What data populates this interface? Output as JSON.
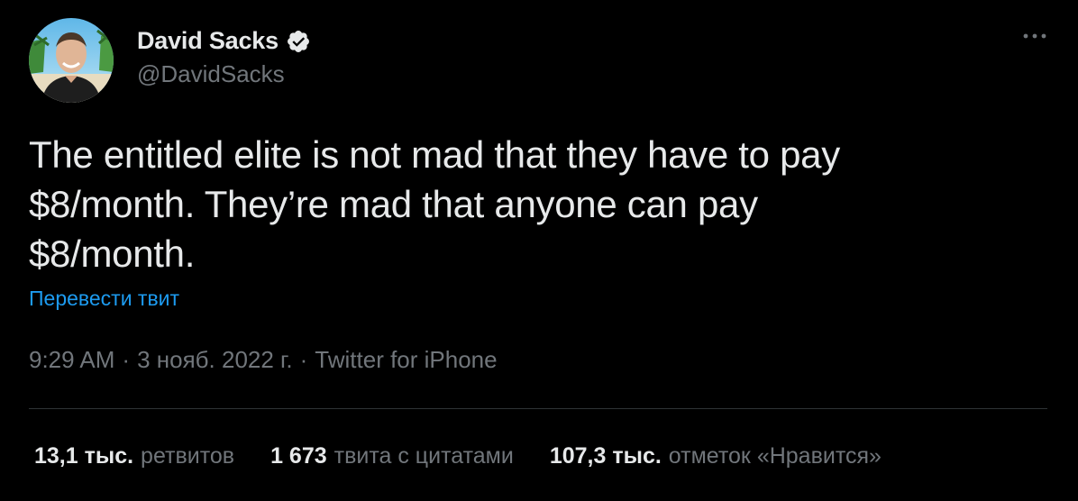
{
  "author": {
    "display_name": "David Sacks",
    "handle": "@DavidSacks",
    "verified": true,
    "verified_icon": "verified-badge-icon",
    "avatar_icon": "profile-photo"
  },
  "tweet": {
    "text": "The entitled elite is not mad that they have to pay\n$8/month. They’re mad that anyone can pay\n$8/month.",
    "translate_label": "Перевести твит"
  },
  "meta": {
    "time": "9:29 AM",
    "separator": "·",
    "date": "3 нояб. 2022 г.",
    "source": "Twitter for iPhone"
  },
  "stats": {
    "retweets_count": "13,1 тыс.",
    "retweets_label": "ретвитов",
    "quotes_count": "1 673",
    "quotes_label": "твита с цитатами",
    "likes_count": "107,3 тыс.",
    "likes_label": "отметок «Нравится»"
  },
  "colors": {
    "background": "#000000",
    "text_primary": "#e7e9ea",
    "text_secondary": "#71767b",
    "link": "#1d9bf0",
    "divider": "#2f3336"
  },
  "more_icon": "more-horizontal-icon"
}
